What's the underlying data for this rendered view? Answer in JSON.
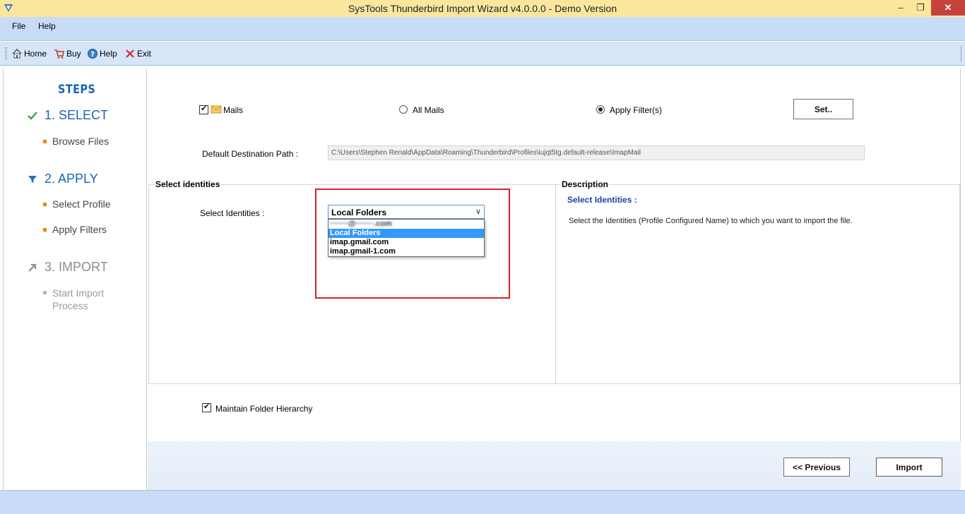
{
  "window": {
    "title": "SysTools Thunderbird Import Wizard v4.0.0.0 - Demo Version",
    "minimize": "–",
    "maximize": "❐",
    "close": "✕"
  },
  "menu": {
    "file": "File",
    "help": "Help"
  },
  "toolbar": {
    "home": "Home",
    "buy": "Buy",
    "help": "Help",
    "exit": "Exit"
  },
  "steps": {
    "title": "STEPS",
    "step1": {
      "label": "1. SELECT",
      "sub": [
        "Browse Files"
      ]
    },
    "step2": {
      "label": "2. APPLY",
      "sub": [
        "Select Profile",
        "Apply Filters"
      ]
    },
    "step3": {
      "label": "3. IMPORT",
      "sub": [
        "Start Import Process"
      ]
    }
  },
  "filters": {
    "mails_label": "Mails",
    "mails_checked": true,
    "all_mails_label": "All Mails",
    "apply_filters_label": "Apply Filter(s)",
    "selected": "Apply Filter(s)",
    "set_button": "Set.."
  },
  "destination": {
    "label": "Default Destination Path :",
    "value": "C:\\Users\\Stephen Renald\\AppData\\Roaming\\Thunderbird\\Profiles\\iujqt5tg.default-release\\ImapMail"
  },
  "identities": {
    "group_title": "Select identities",
    "label": "Select Identities :",
    "selected": "Local Folders",
    "options": [
      {
        "label": "·······@·······.com",
        "blurred": true
      },
      {
        "label": "Local Folders",
        "selected": true
      },
      {
        "label": "imap.gmail.com"
      },
      {
        "label": "imap.gmail-1.com"
      }
    ]
  },
  "description": {
    "group_title": "Description",
    "heading": "Select  Identities  :",
    "text": "Select the Identities (Profile Configured Name) to  which  you want to import the file."
  },
  "options": {
    "maintain_hierarchy_label": "Maintain Folder Hierarchy",
    "maintain_hierarchy_checked": true
  },
  "nav": {
    "previous": "<< Previous",
    "import": "Import"
  },
  "colors": {
    "title_bar": "#fbe69e",
    "menu_bar": "#c9dcf7",
    "steps_accent": "#1a63b8",
    "highlight": "#d8202b",
    "selection": "#3399ff"
  }
}
